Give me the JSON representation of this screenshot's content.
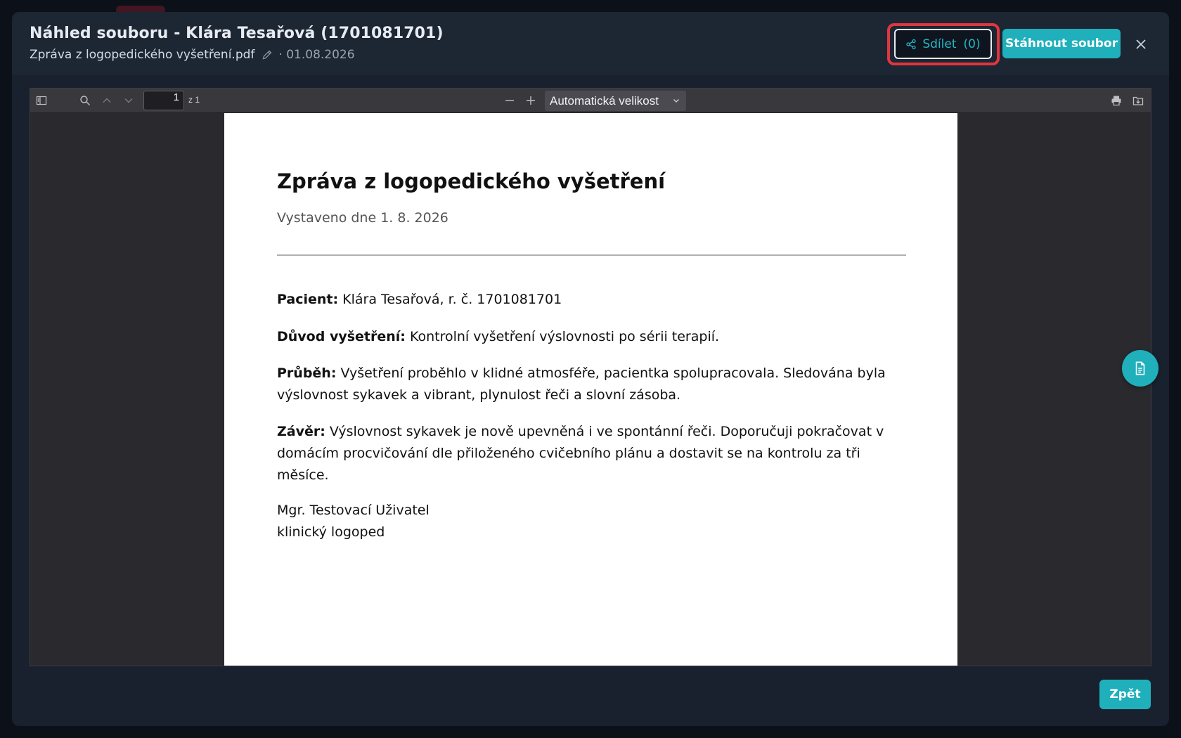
{
  "modal": {
    "title": "Náhled souboru - Klára Tesařová (1701081701)",
    "filename": "Zpráva z logopedického vyšetření.pdf",
    "date": "· 01.08.2026"
  },
  "actions": {
    "share_label": "Sdílet",
    "share_count": "(0)",
    "download_label": "Stáhnout soubor",
    "back_label": "Zpět"
  },
  "viewer": {
    "page_number": "1",
    "page_of": "z 1",
    "zoom_option": "Automatická velikost"
  },
  "document": {
    "title": "Zpráva z logopedického vyšetření",
    "issued": "Vystaveno dne 1. 8. 2026",
    "patient_label": "Pacient:",
    "patient_value": " Klára Tesařová, r. č. 1701081701",
    "reason_label": "Důvod vyšetření:",
    "reason_value": " Kontrolní vyšetření výslovnosti po sérii terapií.",
    "course_label": "Průběh:",
    "course_value": " Vyšetření proběhlo v klidné atmosféře, pacientka spolupracovala. Sledována byla výslovnost sykavek a vibrant, plynulost řeči a slovní zásoba.",
    "conclusion_label": "Závěr:",
    "conclusion_value": " Výslovnost sykavek je nově upevněná i ve spontánní řeči. Doporučuji pokračovat v domácím procvičování dle přiloženého cvičebního plánu a dostavit se na kontrolu za tři měsíce.",
    "signature_name": "Mgr. Testovací Uživatel",
    "signature_role": "klinický logoped"
  },
  "colors": {
    "accent": "#1fb0bc",
    "highlight": "#e0363f",
    "modal_bg": "#19212e"
  },
  "icons": [
    "share-icon",
    "pencil-icon",
    "close-icon",
    "sidebar-toggle-icon",
    "search-icon",
    "chevron-up-icon",
    "chevron-down-icon",
    "zoom-out-icon",
    "zoom-in-icon",
    "print-icon",
    "save-icon",
    "document-icon"
  ]
}
